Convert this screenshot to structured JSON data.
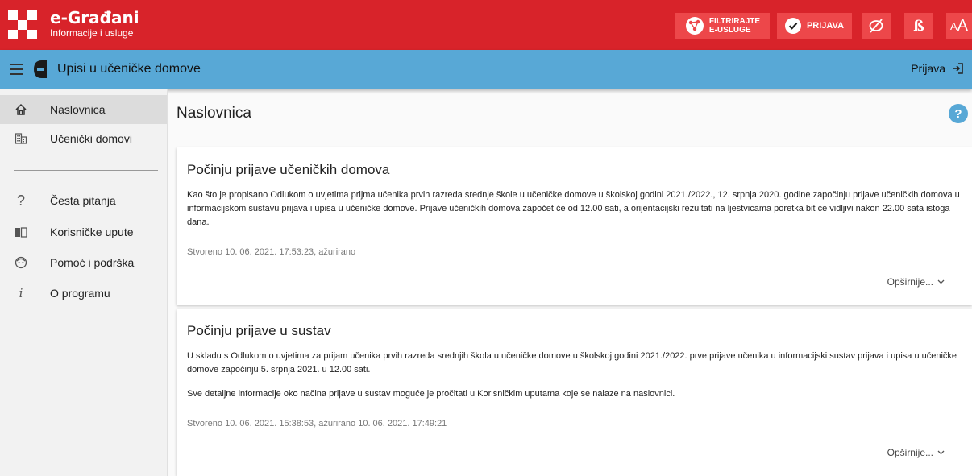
{
  "brand": {
    "title": "e-Građani",
    "subtitle": "Informacije i usluge"
  },
  "topbar": {
    "filter_label_line1": "FILTRIRAJTE",
    "filter_label_line2": "E-USLUGE",
    "login_label": "PRIJAVA",
    "font_toggle_small": "A",
    "font_toggle_large": "A",
    "dyslexic_label": "ß"
  },
  "appbar": {
    "title": "Upisi u učeničke domove",
    "login_link": "Prijava"
  },
  "sidebar": {
    "items": [
      {
        "label": "Naslovnica",
        "icon": "home-icon",
        "active": true
      },
      {
        "label": "Učenički domovi",
        "icon": "building-icon",
        "active": false
      },
      {
        "label": "Česta pitanja",
        "icon": "question-icon",
        "active": false
      },
      {
        "label": "Korisničke upute",
        "icon": "book-icon",
        "active": false
      },
      {
        "label": "Pomoć i podrška",
        "icon": "support-icon",
        "active": false
      },
      {
        "label": "O programu",
        "icon": "info-icon",
        "active": false
      }
    ]
  },
  "main": {
    "page_title": "Naslovnica",
    "help_label": "?",
    "news": [
      {
        "title": "Počinju prijave učeničkih domova",
        "body": [
          "Kao što je propisano Odlukom o uvjetima prijma učenika prvih razreda srednje škole u učeničke domove u školskoj godini 2021./2022., 12. srpnja 2020. godine započinju prijave učeničkih domova u informacijskom sustavu prijava i upisa u učeničke domove. Prijave učeničkih domova započet će od 12.00 sati, a orijentacijski rezultati na ljestvicama poretka bit će vidljivi nakon 22.00 sata istoga dana."
        ],
        "meta": "Stvoreno 10. 06. 2021. 17:53:23, ažurirano",
        "more": "Opširnije..."
      },
      {
        "title": "Počinju prijave u sustav",
        "body": [
          "U skladu s Odlukom o uvjetima za prijam učenika prvih razreda srednjih škola u učeničke domove u školskoj godini 2021./2022. prve prijave učenika u informacijski sustav prijava i upisa u učeničke domove započinju 5. srpnja 2021. u 12.00 sati.",
          "Sve detaljne informacije oko načina prijave u sustav moguće je pročitati u Korisničkim uputama koje se nalaze na naslovnici."
        ],
        "meta": "Stvoreno 10. 06. 2021. 15:38:53, ažurirano 10. 06. 2021. 17:49:21",
        "more": "Opširnije..."
      }
    ]
  },
  "colors": {
    "topbar": "#d8232a",
    "topbar_button": "#ed474a",
    "appbar": "#58a8d6",
    "sidebar": "#f2f2f2",
    "sidebar_active": "#dcdcdc"
  }
}
